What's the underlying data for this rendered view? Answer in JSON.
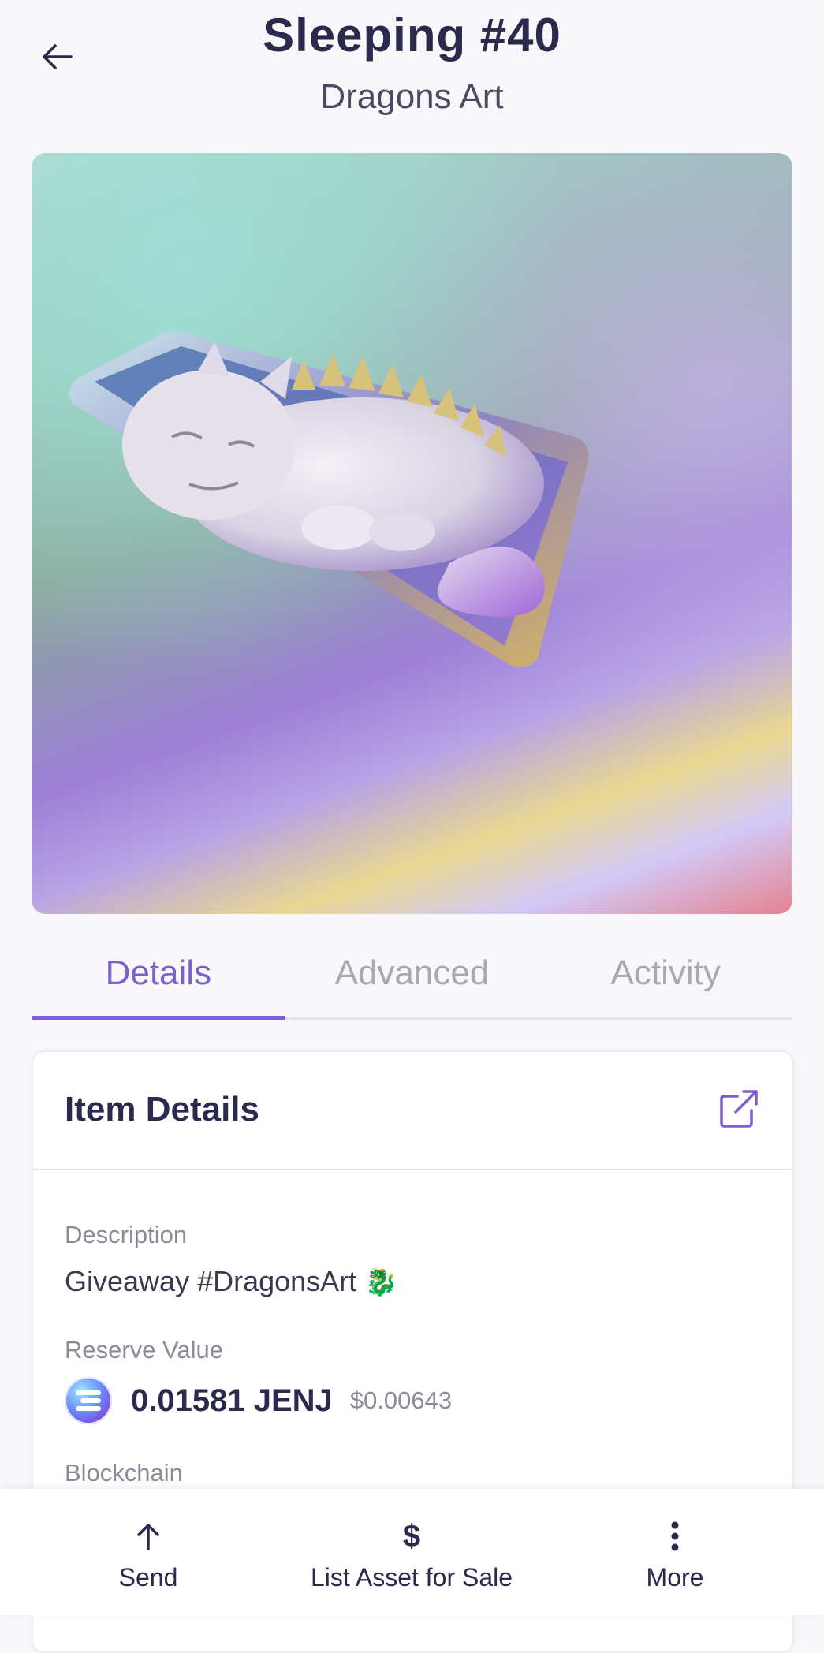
{
  "header": {
    "title": "Sleeping  #40",
    "subtitle": "Dragons Art"
  },
  "artwork": {
    "icon": "dragon-artwork"
  },
  "tabs": [
    {
      "label": "Details",
      "active": true
    },
    {
      "label": "Advanced",
      "active": false
    },
    {
      "label": "Activity",
      "active": false
    }
  ],
  "item_details": {
    "title": "Item Details",
    "description_label": "Description",
    "description_value": "Giveaway #DragonsArt",
    "description_emoji": "🐉",
    "reserve_label": "Reserve Value",
    "reserve_amount": "0.01581 JENJ",
    "reserve_usd": "$0.00643",
    "blockchain_label": "Blockchain"
  },
  "bottom_bar": {
    "send_label": "Send",
    "list_label": "List Asset for Sale",
    "list_icon": "$",
    "more_label": "More"
  },
  "colors": {
    "accent": "#7c5fd1",
    "text_primary": "#2b2a4c",
    "text_muted": "#8b8a99",
    "background": "#f8f8fa"
  }
}
